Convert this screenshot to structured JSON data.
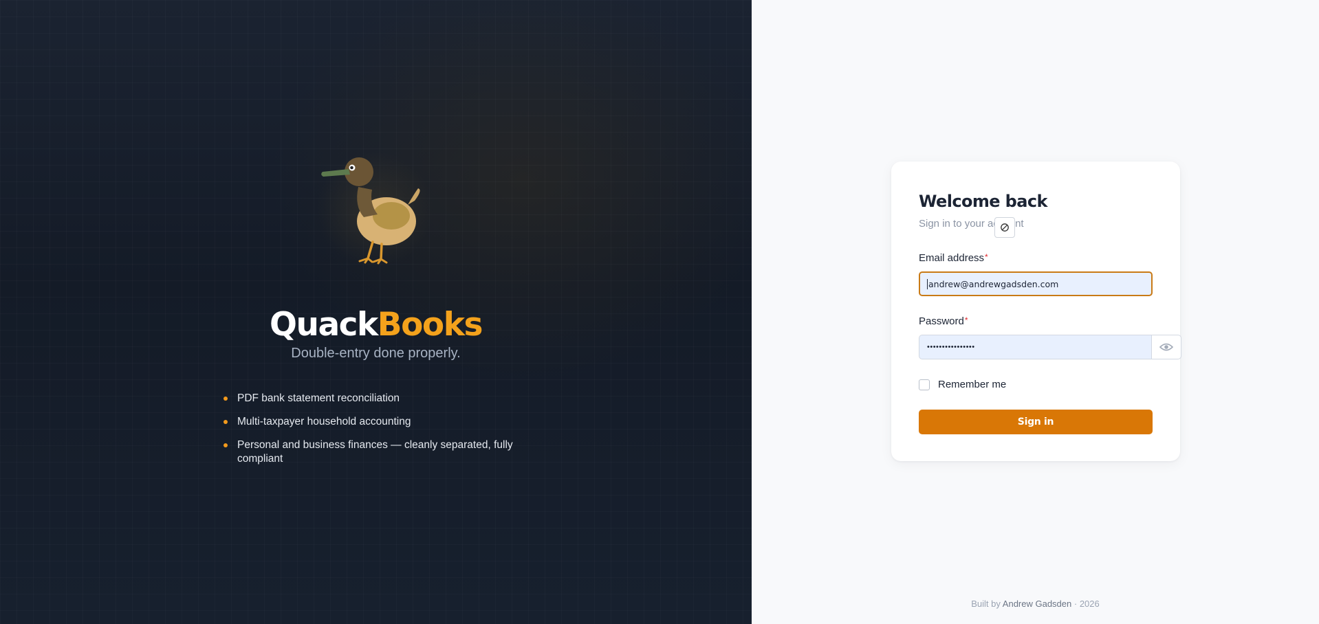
{
  "brand": {
    "name_part1": "Quack",
    "name_part2": "Books",
    "tagline": "Double-entry done properly."
  },
  "features": [
    "PDF bank statement reconciliation",
    "Multi-taxpayer household accounting",
    "Personal and business finances — cleanly separated, fully compliant"
  ],
  "login": {
    "title": "Welcome back",
    "subtitle": "Sign in to your account",
    "email_label": "Email address",
    "email_value": "andrew@andrewgadsden.com",
    "password_label": "Password",
    "password_value": "••••••••••••••••",
    "required_marker": "*",
    "remember_label": "Remember me",
    "remember_checked": false,
    "submit_label": "Sign in",
    "overlay_icon": "block-icon"
  },
  "footer": {
    "prefix": "Built by",
    "author": "Andrew Gadsden",
    "suffix": "· 2026"
  },
  "colors": {
    "accent": "#d97706",
    "brand_orange": "#f4a21c",
    "left_bg": "#161e2b",
    "right_bg": "#f8f9fb",
    "autofill_bg": "#e8f0fe"
  }
}
